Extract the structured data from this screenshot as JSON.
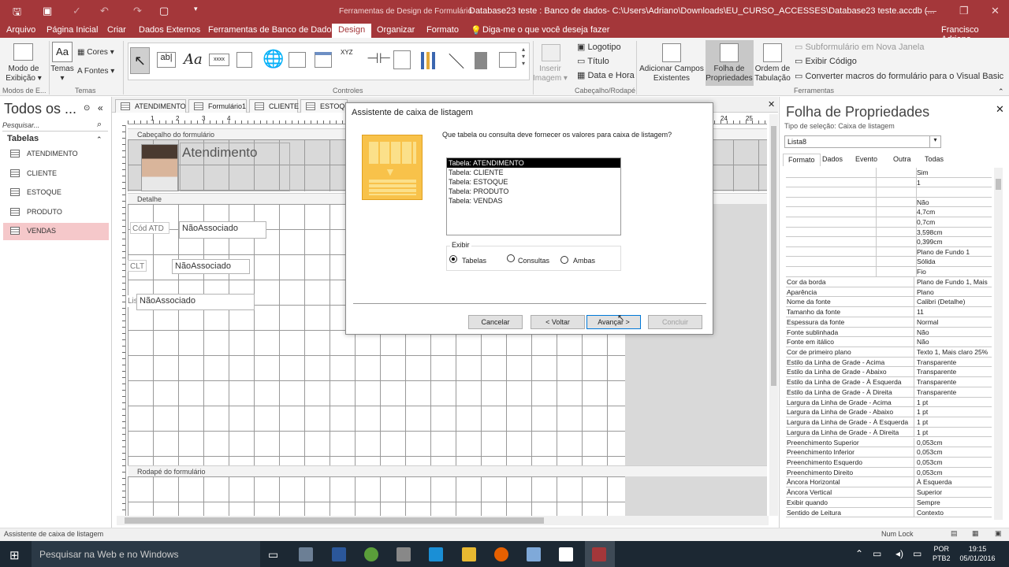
{
  "window": {
    "tools_label": "Ferramentas de Design de Formulário",
    "title": "Database23 teste : Banco de dados- C:\\Users\\Adriano\\Downloads\\EU_CURSO_ACCESSES\\Database23 teste.accdb (..."
  },
  "menu": {
    "tabs": [
      "Arquivo",
      "Página Inicial",
      "Criar",
      "Dados Externos",
      "Ferramentas de Banco de Dados",
      "Design",
      "Organizar",
      "Formato"
    ],
    "active": "Design",
    "tell_me": "Diga-me o que você deseja fazer",
    "user": "Francisco Adriano"
  },
  "ribbon": {
    "view_btn": "Modo de",
    "view_btn2": "Exibição",
    "themes": "Temas",
    "colors": "Cores",
    "fonts": "Fontes",
    "insert_image": "Inserir",
    "insert_image2": "Imagem",
    "logo": "Logotipo",
    "title_btn": "Título",
    "datetime": "Data e Hora",
    "add_fields": "Adicionar Campos",
    "add_fields2": "Existentes",
    "props_sheet": "Folha de",
    "props_sheet2": "Propriedades",
    "tab_order": "Ordem de",
    "tab_order2": "Tabulação",
    "subform": "Subformulário em Nova Janela",
    "view_code": "Exibir Código",
    "convert": "Converter macros do formulário para o Visual Basic",
    "groups": {
      "views": "Modos de E...",
      "themes": "Temas",
      "controls": "Controles",
      "header": "Cabeçalho/Rodapé",
      "tools": "Ferramentas"
    }
  },
  "nav": {
    "title": "Todos os ...",
    "search": "Pesquisar...",
    "section": "Tabelas",
    "items": [
      "ATENDIMENTO",
      "CLIENTE",
      "ESTOQUE",
      "PRODUTO",
      "VENDAS"
    ],
    "selected": "VENDAS"
  },
  "doc_tabs": [
    "ATENDIMENTO",
    "Formulário1",
    "CLIENTE",
    "ESTOQUE"
  ],
  "form": {
    "header_bar": "Cabeçalho do formulário",
    "title": "Atendimento",
    "detail_bar": "Detalhe",
    "footer_bar": "Rodapé do formulário",
    "label1": "Cód ATD",
    "field1": "NãoAssociado",
    "label2": "CLT",
    "field2": "NãoAssociado",
    "label3": "Lis",
    "field3": "NãoAssociado"
  },
  "ruler": [
    "1",
    "2",
    "3",
    "4",
    "24",
    "25"
  ],
  "dialog": {
    "title": "Assistente de caixa de listagem",
    "question": "Que tabela ou consulta deve fornecer os valores para caixa de listagem?",
    "list": [
      "Tabela: ATENDIMENTO",
      "Tabela: CLIENTE",
      "Tabela: ESTOQUE",
      "Tabela: PRODUTO",
      "Tabela: VENDAS"
    ],
    "view_label": "Exibir",
    "radios": [
      "Tabelas",
      "Consultas",
      "Ambas"
    ],
    "selected_radio": "Tabelas",
    "cancel": "Cancelar",
    "back": "< Voltar",
    "next": "Avançar >",
    "finish": "Concluir"
  },
  "props": {
    "title": "Folha de Propriedades",
    "selection_type": "Tipo de seleção:  Caixa de listagem",
    "object": "Lista8",
    "tabs": [
      "Formato",
      "Dados",
      "Evento",
      "Outra",
      "Todas"
    ],
    "active_tab": "Formato",
    "top_values": [
      "Sim",
      "1",
      "",
      "Não",
      "4,7cm",
      "0,7cm",
      "3,598cm",
      "0,399cm",
      "Plano de Fundo 1",
      "Sólida",
      "Fio"
    ],
    "rows": [
      [
        "Cor da borda",
        "Plano de Fundo 1, Mais"
      ],
      [
        "Aparência",
        "Plano"
      ],
      [
        "Nome da fonte",
        "Calibri (Detalhe)"
      ],
      [
        "Tamanho da fonte",
        "11"
      ],
      [
        "Espessura da fonte",
        "Normal"
      ],
      [
        "Fonte sublinhada",
        "Não"
      ],
      [
        "Fonte em itálico",
        "Não"
      ],
      [
        "Cor de primeiro plano",
        "Texto 1, Mais claro 25%"
      ],
      [
        "Estilo da Linha de Grade - Acima",
        "Transparente"
      ],
      [
        "Estilo da Linha de Grade - Abaixo",
        "Transparente"
      ],
      [
        "Estilo da Linha de Grade - À Esquerda",
        "Transparente"
      ],
      [
        "Estilo da Linha de Grade - À Direita",
        "Transparente"
      ],
      [
        "Largura da Linha de Grade - Acima",
        "1 pt"
      ],
      [
        "Largura da Linha de Grade - Abaixo",
        "1 pt"
      ],
      [
        "Largura da Linha de Grade - À Esquerda",
        "1 pt"
      ],
      [
        "Largura da Linha de Grade - À Direita",
        "1 pt"
      ],
      [
        "Preenchimento Superior",
        "0,053cm"
      ],
      [
        "Preenchimento Inferior",
        "0,053cm"
      ],
      [
        "Preenchimento Esquerdo",
        "0,053cm"
      ],
      [
        "Preenchimento Direito",
        "0,053cm"
      ],
      [
        "Âncora Horizontal",
        "À Esquerda"
      ],
      [
        "Âncora Vertical",
        "Superior"
      ],
      [
        "Exibir quando",
        "Sempre"
      ],
      [
        "Sentido de Leitura",
        "Contexto"
      ]
    ]
  },
  "status": {
    "left": "Assistente de caixa de listagem",
    "numlock": "Num Lock"
  },
  "taskbar": {
    "search": "Pesquisar na Web e no Windows",
    "lang": "POR",
    "lang2": "PTB2",
    "time": "19:15",
    "date": "05/01/2016"
  },
  "colors": {
    "accent": "#a4373a",
    "nav_selected": "#f5c8ca"
  }
}
